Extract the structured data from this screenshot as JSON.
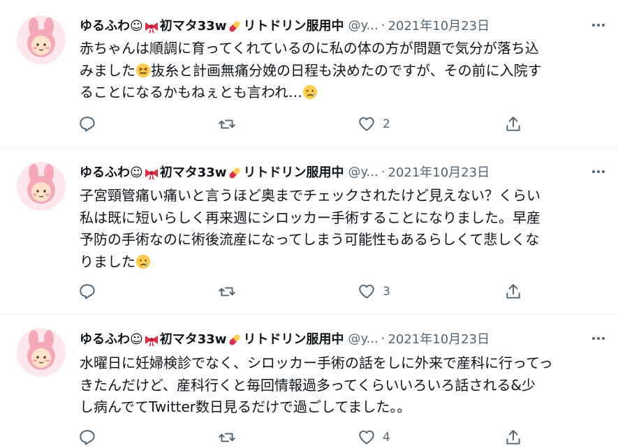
{
  "colors": {
    "text": "#0f1419",
    "muted": "#536471",
    "divider": "#eff3f4",
    "avatar_bg": "#f5a9b8"
  },
  "tweets": [
    {
      "name": "ゆるふわ☺",
      "name_suffix": "初マタ33w",
      "name_tail": "リトドリン服用中",
      "handle": "@y...",
      "date": "2021年10月23日",
      "body_1": "赤ちゃんは順調に育ってくれているのに私の体の方が問題で気分が落ち込\nみました",
      "body_2": "抜糸と計画無痛分娩の日程も決めたのですが、その前に入院す\nることになるかもねぇとも言われ…",
      "body_3": "",
      "like_count": "2"
    },
    {
      "name": "ゆるふわ☺",
      "name_suffix": "初マタ33w",
      "name_tail": "リトドリン服用中",
      "handle": "@y...",
      "date": "2021年10月23日",
      "body_1": "子宮頸管痛い痛いと言うほど奥までチェックされたけど見えない？くらい\n私は既に短いらしく再来週にシロッカー手術することになりました。早産\n予防の手術なのに術後流産になってしまう可能性もあるらしくて悲しくな\nりました",
      "body_2": "",
      "body_3": "",
      "like_count": "3"
    },
    {
      "name": "ゆるふわ☺",
      "name_suffix": "初マタ33w",
      "name_tail": "リトドリン服用中",
      "handle": "@y...",
      "date": "2021年10月23日",
      "body_1": "水曜日に妊婦検診でなく、シロッカー手術の話をしに外来で産科に行ってっ\nきたんだけど、産科行くと毎回情報過多ってくらいいろいろ話される&少\nし病んでてTwitter数日見るだけで過ごしてました。。",
      "body_2": "",
      "body_3": "",
      "like_count": "4"
    }
  ]
}
